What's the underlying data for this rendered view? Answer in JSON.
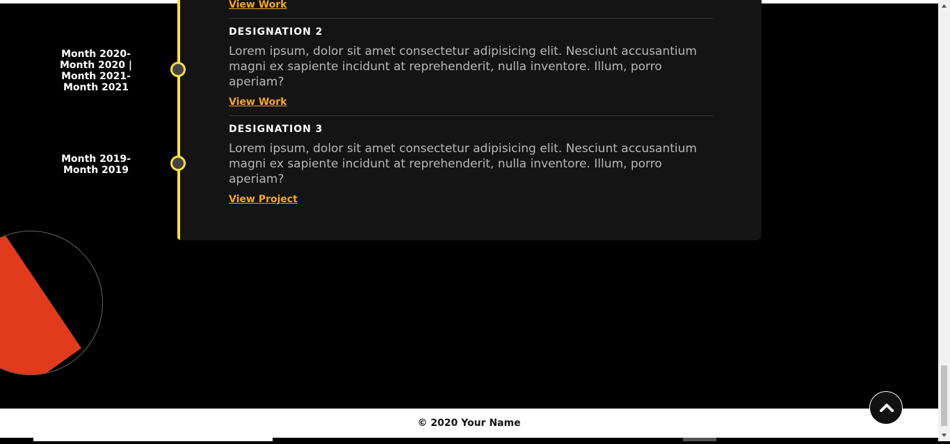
{
  "timeline": {
    "top_link": "View Work",
    "entries": [
      {
        "date": "Month 2020-\nMonth 2020 |\nMonth 2021-\nMonth 2021",
        "title": "DESIGNATION 2",
        "description": "Lorem ipsum, dolor sit amet consectetur adipisicing elit. Nesciunt accusantium magni ex sapiente incidunt at reprehenderit, nulla inventore. Illum, porro aperiam?",
        "link": "View Work"
      },
      {
        "date": "Month 2019-\nMonth 2019",
        "title": "DESIGNATION 3",
        "description": "Lorem ipsum, dolor sit amet consectetur adipisicing elit. Nesciunt accusantium magni ex sapiente incidunt at reprehenderit, nulla inventore. Illum, porro aperiam?",
        "link": "View Project"
      }
    ]
  },
  "footer": {
    "copyright": "© 2020 Your Name"
  },
  "icons": {
    "back_to_top": "chevron-up-icon"
  },
  "colors": {
    "accent_yellow": "#fde047",
    "link_orange": "#f5a623",
    "deco_red": "#e23a1c",
    "card_bg": "#141414"
  }
}
